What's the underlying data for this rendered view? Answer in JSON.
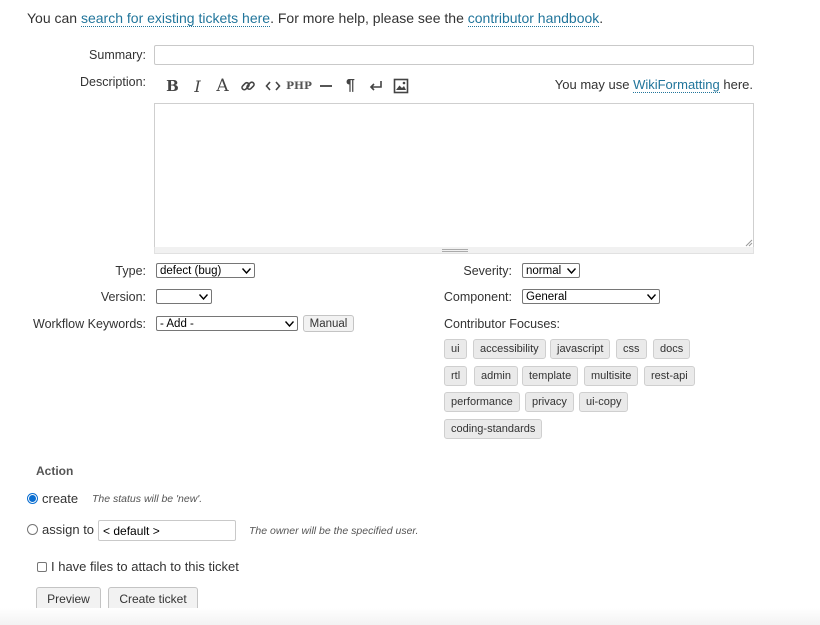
{
  "intro": {
    "prefix": "You can ",
    "search_link": "search for existing tickets here",
    "middle": ". For more help, please see the ",
    "handbook_link": "contributor handbook",
    "suffix": "."
  },
  "form": {
    "summary_label": "Summary:",
    "summary_value": "",
    "description_label": "Description:",
    "description_value": "",
    "wiki_prefix": "You may use ",
    "wiki_link": "WikiFormatting",
    "wiki_suffix": " here.",
    "toolbar": {
      "bold": "B",
      "italic": "I",
      "heading": "A",
      "php": "PHP",
      "pilcrow": "¶"
    }
  },
  "fields": {
    "type_label": "Type:",
    "type_value": "defect (bug)",
    "version_label": "Version:",
    "version_value": "",
    "keywords_label": "Workflow Keywords:",
    "keywords_value": "- Add -",
    "manual_button": "Manual",
    "severity_label": "Severity:",
    "severity_value": "normal",
    "component_label": "Component:",
    "component_value": "General",
    "focuses_label": "Contributor Focuses:",
    "focuses": [
      "ui",
      "accessibility",
      "javascript",
      "css",
      "docs",
      "rtl",
      "admin",
      "template",
      "multisite",
      "rest-api",
      "performance",
      "privacy",
      "ui-copy",
      "coding-standards"
    ]
  },
  "action": {
    "heading": "Action",
    "create_label": "create",
    "create_hint": "The status will be 'new'.",
    "assign_label": "assign to",
    "assign_value": "< default >",
    "assign_hint": "The owner will be the specified user.",
    "attach_label": "I have files to attach to this ticket",
    "preview_button": "Preview",
    "create_button": "Create ticket"
  }
}
